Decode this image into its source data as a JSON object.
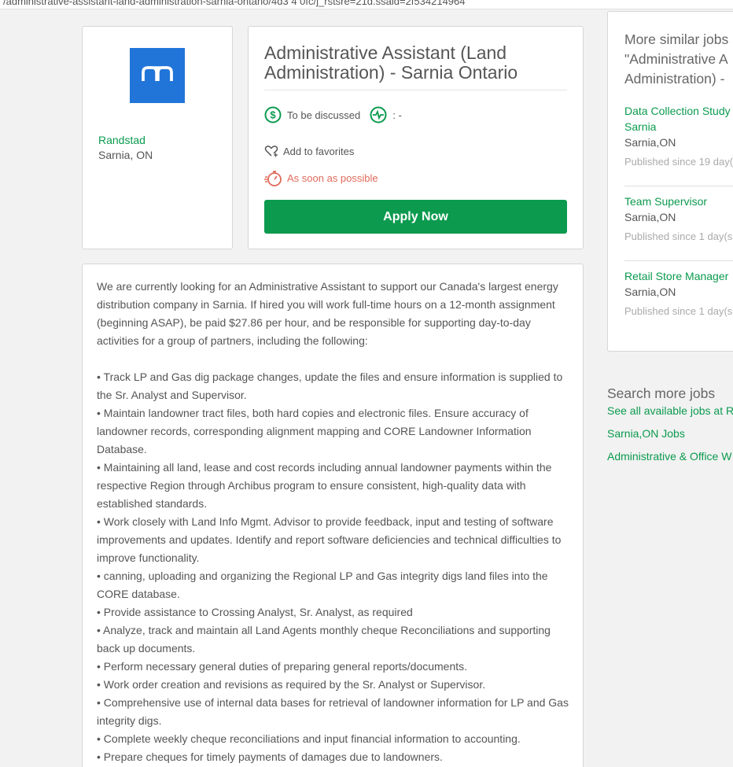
{
  "browser": {
    "url": "/administrative-assistant-land-administration-sarnia-ontario/4d3 4 0fc/j_rstsre=21d.ssaid=2f534214964"
  },
  "company": {
    "logo_icon": "randstad-logo-icon",
    "name": "Randstad",
    "location": "Sarnia, ON"
  },
  "job": {
    "title": "Administrative Assistant (Land Administration) - Sarnia Ontario",
    "salary": "To be discussed",
    "salary_icon": "dollar-icon",
    "activity_icon": "pulse-icon",
    "activity": ": -",
    "favorites_label": "Add to favorites",
    "start_label": "As soon as possible",
    "apply_label": "Apply Now"
  },
  "description": {
    "intro": "We are currently looking for an Administrative Assistant to support our Canada's largest energy distribution company in Sarnia. If hired you will work full-time hours on a 12-month assignment (beginning ASAP), be paid $27.86 per hour, and be responsible for supporting day-to-day activities for a group of partners, including the following:",
    "bullets": [
      "• Track LP and Gas dig package changes, update the files and ensure information is supplied to the Sr. Analyst and Supervisor.",
      "• Maintain landowner tract files, both hard copies and electronic files. Ensure accuracy of landowner records, corresponding alignment mapping and CORE Landowner Information Database.",
      "• Maintaining all land, lease and cost records including annual landowner payments within the respective Region through Archibus program to ensure consistent, high-quality data with established standards.",
      "• Work closely with Land Info Mgmt. Advisor to provide feedback, input and testing of software improvements and updates. Identify and report software deficiencies and technical difficulties to improve functionality.",
      "• canning, uploading and organizing the Regional LP and Gas integrity digs land files into the CORE database.",
      "• Provide assistance to Crossing Analyst, Sr. Analyst, as required",
      "• Analyze, track and maintain all Land Agents monthly cheque Reconciliations and supporting back up documents.",
      "• Perform necessary general duties of preparing general reports/documents.",
      "• Work order creation and revisions as required by the Sr. Analyst or Supervisor.",
      "• Comprehensive use of internal data bases for retrieval of landowner information for LP and Gas integrity digs.",
      "• Complete weekly cheque reconciliations and input financial information to accounting.",
      "• Prepare cheques for timely payments of damages due to landowners."
    ]
  },
  "similar": {
    "heading_line1": "More similar jobs",
    "heading_line2": "\"Administrative A",
    "heading_line3": "Administration) -",
    "items": [
      {
        "title": "Data Collection Study",
        "title2": "Sarnia",
        "location": "Sarnia,ON",
        "published": "Published since 19 day("
      },
      {
        "title": "Team Supervisor",
        "title2": "",
        "location": "Sarnia,ON",
        "published": "Published since 1 day(s"
      },
      {
        "title": "Retail Store Manager",
        "title2": "",
        "location": "Sarnia,ON",
        "published": "Published since 1 day(s"
      }
    ]
  },
  "search_more": {
    "heading": "Search more jobs",
    "links": [
      "See all available jobs at R",
      "Sarnia,ON Jobs",
      "Administrative & Office W"
    ]
  },
  "colors": {
    "accent": "#0b9a4e",
    "logo_blue": "#2175d9",
    "start_red": "#e06a5a"
  }
}
